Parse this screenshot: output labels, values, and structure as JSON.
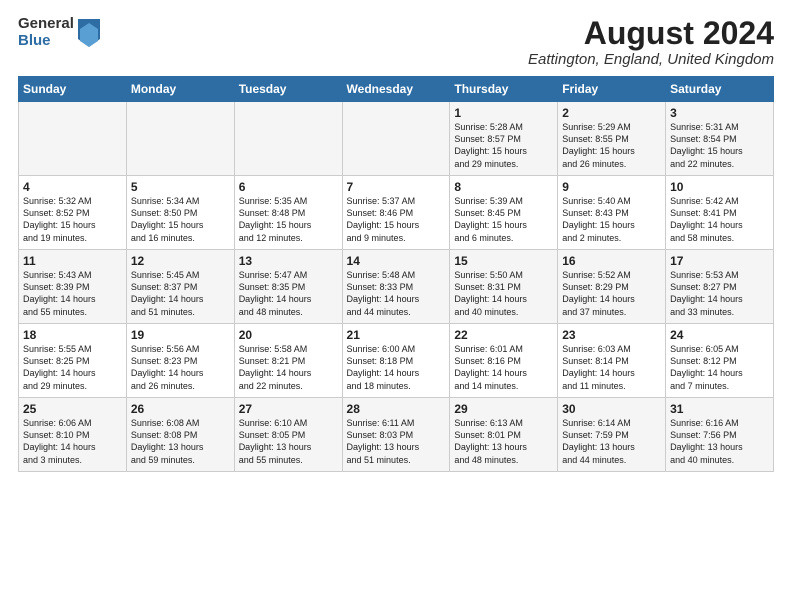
{
  "logo": {
    "general": "General",
    "blue": "Blue"
  },
  "title": "August 2024",
  "location": "Eattington, England, United Kingdom",
  "days_header": [
    "Sunday",
    "Monday",
    "Tuesday",
    "Wednesday",
    "Thursday",
    "Friday",
    "Saturday"
  ],
  "weeks": [
    [
      {
        "day": "",
        "content": ""
      },
      {
        "day": "",
        "content": ""
      },
      {
        "day": "",
        "content": ""
      },
      {
        "day": "",
        "content": ""
      },
      {
        "day": "1",
        "content": "Sunrise: 5:28 AM\nSunset: 8:57 PM\nDaylight: 15 hours\nand 29 minutes."
      },
      {
        "day": "2",
        "content": "Sunrise: 5:29 AM\nSunset: 8:55 PM\nDaylight: 15 hours\nand 26 minutes."
      },
      {
        "day": "3",
        "content": "Sunrise: 5:31 AM\nSunset: 8:54 PM\nDaylight: 15 hours\nand 22 minutes."
      }
    ],
    [
      {
        "day": "4",
        "content": "Sunrise: 5:32 AM\nSunset: 8:52 PM\nDaylight: 15 hours\nand 19 minutes."
      },
      {
        "day": "5",
        "content": "Sunrise: 5:34 AM\nSunset: 8:50 PM\nDaylight: 15 hours\nand 16 minutes."
      },
      {
        "day": "6",
        "content": "Sunrise: 5:35 AM\nSunset: 8:48 PM\nDaylight: 15 hours\nand 12 minutes."
      },
      {
        "day": "7",
        "content": "Sunrise: 5:37 AM\nSunset: 8:46 PM\nDaylight: 15 hours\nand 9 minutes."
      },
      {
        "day": "8",
        "content": "Sunrise: 5:39 AM\nSunset: 8:45 PM\nDaylight: 15 hours\nand 6 minutes."
      },
      {
        "day": "9",
        "content": "Sunrise: 5:40 AM\nSunset: 8:43 PM\nDaylight: 15 hours\nand 2 minutes."
      },
      {
        "day": "10",
        "content": "Sunrise: 5:42 AM\nSunset: 8:41 PM\nDaylight: 14 hours\nand 58 minutes."
      }
    ],
    [
      {
        "day": "11",
        "content": "Sunrise: 5:43 AM\nSunset: 8:39 PM\nDaylight: 14 hours\nand 55 minutes."
      },
      {
        "day": "12",
        "content": "Sunrise: 5:45 AM\nSunset: 8:37 PM\nDaylight: 14 hours\nand 51 minutes."
      },
      {
        "day": "13",
        "content": "Sunrise: 5:47 AM\nSunset: 8:35 PM\nDaylight: 14 hours\nand 48 minutes."
      },
      {
        "day": "14",
        "content": "Sunrise: 5:48 AM\nSunset: 8:33 PM\nDaylight: 14 hours\nand 44 minutes."
      },
      {
        "day": "15",
        "content": "Sunrise: 5:50 AM\nSunset: 8:31 PM\nDaylight: 14 hours\nand 40 minutes."
      },
      {
        "day": "16",
        "content": "Sunrise: 5:52 AM\nSunset: 8:29 PM\nDaylight: 14 hours\nand 37 minutes."
      },
      {
        "day": "17",
        "content": "Sunrise: 5:53 AM\nSunset: 8:27 PM\nDaylight: 14 hours\nand 33 minutes."
      }
    ],
    [
      {
        "day": "18",
        "content": "Sunrise: 5:55 AM\nSunset: 8:25 PM\nDaylight: 14 hours\nand 29 minutes."
      },
      {
        "day": "19",
        "content": "Sunrise: 5:56 AM\nSunset: 8:23 PM\nDaylight: 14 hours\nand 26 minutes."
      },
      {
        "day": "20",
        "content": "Sunrise: 5:58 AM\nSunset: 8:21 PM\nDaylight: 14 hours\nand 22 minutes."
      },
      {
        "day": "21",
        "content": "Sunrise: 6:00 AM\nSunset: 8:18 PM\nDaylight: 14 hours\nand 18 minutes."
      },
      {
        "day": "22",
        "content": "Sunrise: 6:01 AM\nSunset: 8:16 PM\nDaylight: 14 hours\nand 14 minutes."
      },
      {
        "day": "23",
        "content": "Sunrise: 6:03 AM\nSunset: 8:14 PM\nDaylight: 14 hours\nand 11 minutes."
      },
      {
        "day": "24",
        "content": "Sunrise: 6:05 AM\nSunset: 8:12 PM\nDaylight: 14 hours\nand 7 minutes."
      }
    ],
    [
      {
        "day": "25",
        "content": "Sunrise: 6:06 AM\nSunset: 8:10 PM\nDaylight: 14 hours\nand 3 minutes."
      },
      {
        "day": "26",
        "content": "Sunrise: 6:08 AM\nSunset: 8:08 PM\nDaylight: 13 hours\nand 59 minutes."
      },
      {
        "day": "27",
        "content": "Sunrise: 6:10 AM\nSunset: 8:05 PM\nDaylight: 13 hours\nand 55 minutes."
      },
      {
        "day": "28",
        "content": "Sunrise: 6:11 AM\nSunset: 8:03 PM\nDaylight: 13 hours\nand 51 minutes."
      },
      {
        "day": "29",
        "content": "Sunrise: 6:13 AM\nSunset: 8:01 PM\nDaylight: 13 hours\nand 48 minutes."
      },
      {
        "day": "30",
        "content": "Sunrise: 6:14 AM\nSunset: 7:59 PM\nDaylight: 13 hours\nand 44 minutes."
      },
      {
        "day": "31",
        "content": "Sunrise: 6:16 AM\nSunset: 7:56 PM\nDaylight: 13 hours\nand 40 minutes."
      }
    ]
  ]
}
